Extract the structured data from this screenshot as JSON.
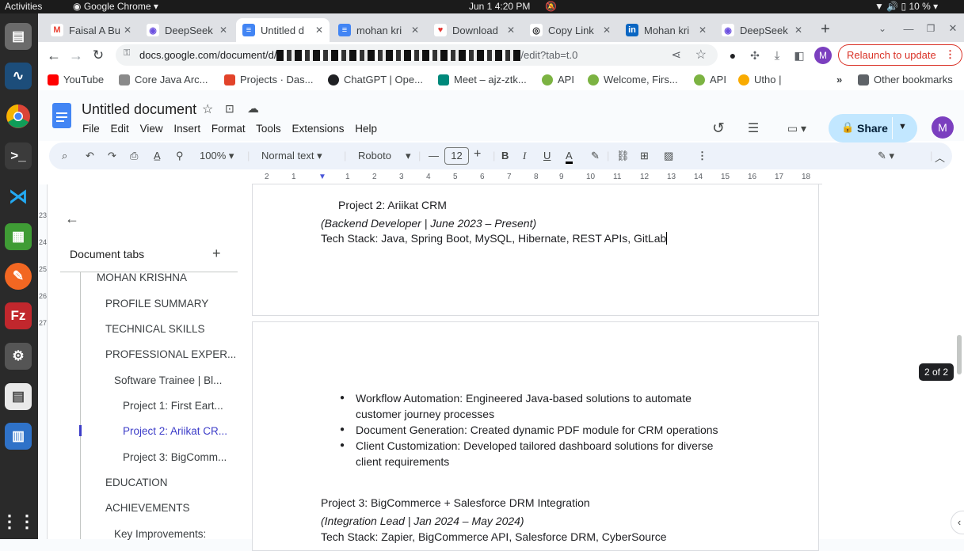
{
  "system": {
    "activities": "Activities",
    "app_name": "Google Chrome",
    "clock": "Jun 1  4:20 PM",
    "battery": "10 %"
  },
  "tabs": [
    {
      "title": "Faisal A Bu",
      "icon_color": "#ea4335",
      "icon": "M"
    },
    {
      "title": "DeepSeek",
      "icon_color": "#6b4fe0",
      "icon": "◉"
    },
    {
      "title": "Untitled d",
      "icon_color": "#4285f4",
      "icon": "≡"
    },
    {
      "title": "mohan kri",
      "icon_color": "#4285f4",
      "icon": "≡"
    },
    {
      "title": "Download",
      "icon_color": "#e53935",
      "icon": "♥"
    },
    {
      "title": "Copy Link",
      "icon_color": "#202124",
      "icon": "◎"
    },
    {
      "title": "Mohan kri",
      "icon_color": "#0a66c2",
      "icon": "in"
    },
    {
      "title": "DeepSeek",
      "icon_color": "#6b4fe0",
      "icon": "◉"
    }
  ],
  "address": {
    "url_prefix": "docs.google.com/document/d/",
    "url_suffix": "/edit?tab=t.0",
    "profile_initial": "M",
    "relaunch_label": "Relaunch to update"
  },
  "bookmarks": [
    {
      "label": "YouTube",
      "color": "#ff0000"
    },
    {
      "label": "Core Java Arc...",
      "color": "#8a8a8a"
    },
    {
      "label": "Projects · Das...",
      "color": "#e2432a"
    },
    {
      "label": "ChatGPT | Ope...",
      "color": "#202124"
    },
    {
      "label": "Meet – ajz-ztk...",
      "color": "#00897b"
    },
    {
      "label": "API",
      "color": "#7cb342"
    },
    {
      "label": "Welcome, Firs...",
      "color": "#7cb342"
    },
    {
      "label": "API",
      "color": "#7cb342"
    },
    {
      "label": "Utho |",
      "color": "#f9ab00"
    }
  ],
  "other_bookmarks": "Other bookmarks",
  "docs": {
    "title": "Untitled document",
    "menus": [
      "File",
      "Edit",
      "View",
      "Insert",
      "Format",
      "Tools",
      "Extensions",
      "Help"
    ],
    "share_label": "Share",
    "account_initial": "M"
  },
  "format": {
    "zoom": "100%",
    "style": "Normal text",
    "font": "Roboto",
    "size": "12"
  },
  "ruler_ticks": [
    "2",
    "1",
    "1",
    "2",
    "3",
    "4",
    "5",
    "6",
    "7",
    "8",
    "9",
    "10",
    "11",
    "12",
    "13",
    "14",
    "15",
    "16",
    "17",
    "18"
  ],
  "vruler_ticks": [
    "23",
    "24",
    "25",
    "26",
    "27"
  ],
  "outline": {
    "heading": "Document tabs",
    "items": [
      {
        "label": "MOHAN KRISHNA",
        "level": 0
      },
      {
        "label": "PROFILE SUMMARY",
        "level": 1
      },
      {
        "label": "TECHNICAL SKILLS",
        "level": 1
      },
      {
        "label": "PROFESSIONAL EXPER...",
        "level": 1
      },
      {
        "label": "Software Trainee | Bl...",
        "level": 2
      },
      {
        "label": "Project 1: First Eart...",
        "level": 3
      },
      {
        "label": "Project 2: Ariikat CR...",
        "level": 3,
        "selected": true
      },
      {
        "label": "Project 3: BigComm...",
        "level": 3
      },
      {
        "label": "EDUCATION",
        "level": 1
      },
      {
        "label": "ACHIEVEMENTS",
        "level": 1
      },
      {
        "label": "Key Improvements:",
        "level": 2
      }
    ]
  },
  "page1": {
    "project_title": "Project 2: Ariikat CRM",
    "role": "(Backend Developer | June 2023 – Present)",
    "stack": "Tech Stack: Java, Spring Boot, MySQL, Hibernate, REST APIs, GitLab"
  },
  "page2": {
    "bullets": [
      "Workflow Automation: Engineered Java-based solutions to automate customer journey processes",
      "Document Generation: Created dynamic PDF module for CRM operations",
      "Client Customization: Developed tailored dashboard solutions for diverse client requirements"
    ],
    "project3_title": "Project 3: BigCommerce + Salesforce DRM Integration",
    "project3_role": "(Integration Lead | Jan 2024 – May 2024)",
    "project3_stack": "Tech Stack: Zapier, BigCommerce API, Salesforce DRM, CyberSource"
  },
  "page_indicator": "2 of 2"
}
